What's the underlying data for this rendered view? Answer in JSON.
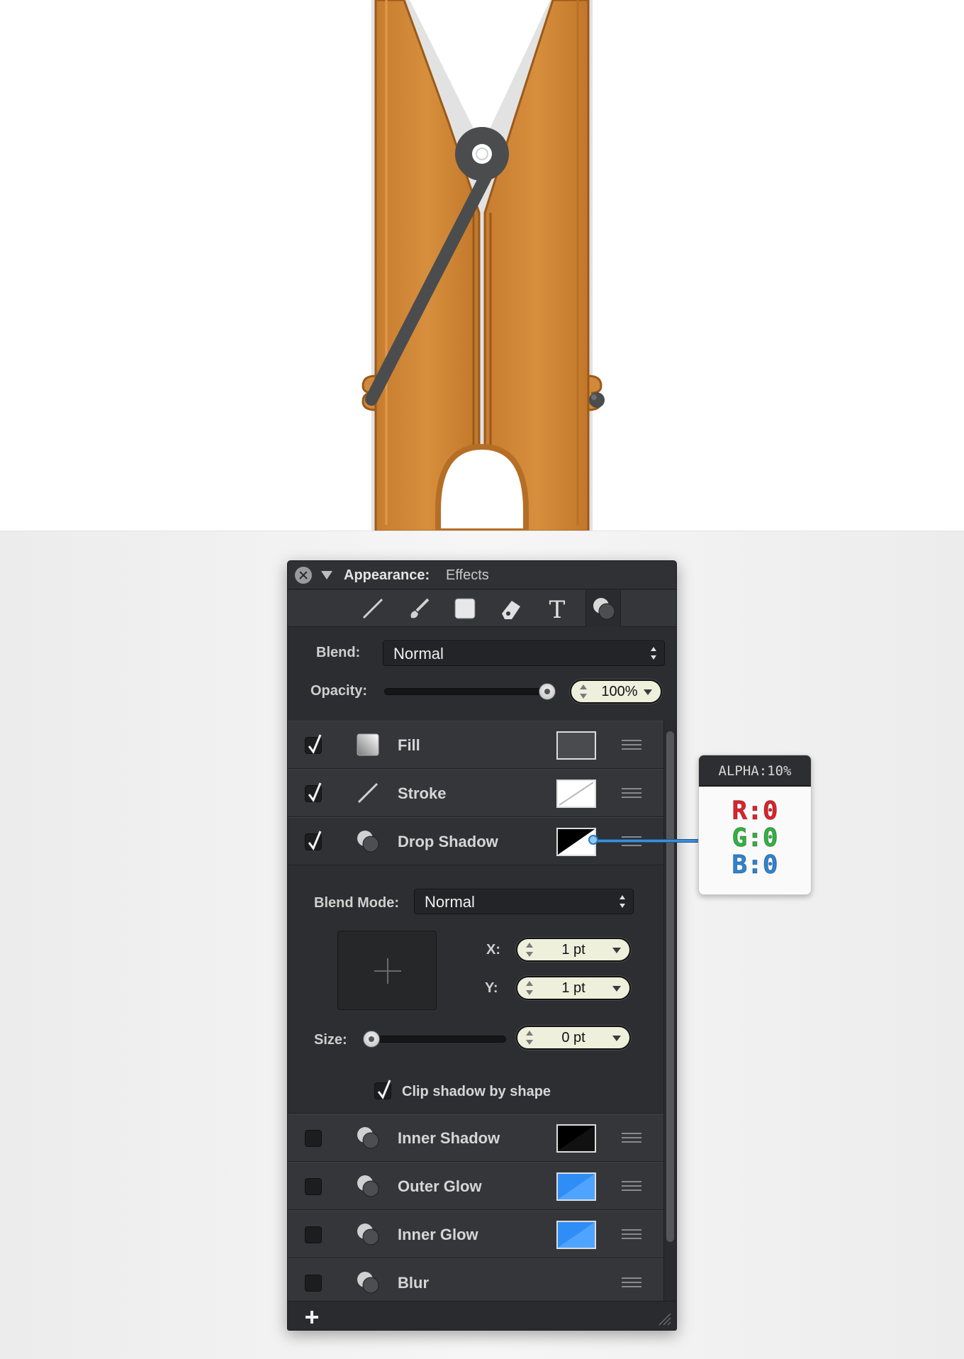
{
  "panel": {
    "title_label": "Appearance:",
    "title_value": "Effects",
    "tools": [
      "stroke-tool-icon",
      "brush-tool-icon",
      "fill-tool-icon",
      "eraser-tool-icon",
      "text-tool-icon",
      "effects-tool-icon"
    ],
    "blend_label": "Blend:",
    "blend_value": "Normal",
    "opacity_label": "Opacity:",
    "opacity_value": "100%",
    "opacity_level": 1.0,
    "rows_top": [
      {
        "label": "Fill",
        "checked": true,
        "icon": "fill-gradient-icon",
        "swatch": "#4a4b4e"
      },
      {
        "label": "Stroke",
        "checked": true,
        "icon": "line-icon",
        "swatch": "none"
      },
      {
        "label": "Drop Shadow",
        "checked": true,
        "icon": "effect-circles-icon",
        "swatch": "#000000"
      }
    ],
    "drop_shadow": {
      "blend_mode_label": "Blend Mode:",
      "blend_mode_value": "Normal",
      "x_label": "X:",
      "x_value": "1 pt",
      "y_label": "Y:",
      "y_value": "1 pt",
      "size_label": "Size:",
      "size_value": "0 pt",
      "size_level": 0.0,
      "clip_label": "Clip shadow by shape",
      "clip_checked": true
    },
    "rows_bottom": [
      {
        "label": "Inner Shadow",
        "checked": false,
        "icon": "effect-circles-icon",
        "swatch": "#000000"
      },
      {
        "label": "Outer Glow",
        "checked": false,
        "icon": "effect-circles-icon",
        "swatch": "#2f8ef5"
      },
      {
        "label": "Inner Glow",
        "checked": false,
        "icon": "effect-circles-icon",
        "swatch": "#2f8ef5"
      },
      {
        "label": "Blur",
        "checked": false,
        "icon": "effect-circles-icon",
        "swatch": ""
      }
    ]
  },
  "tooltip": {
    "alpha": "ALPHA:10%",
    "r": "R:0",
    "g": "G:0",
    "b": "B:0",
    "colors": {
      "r": "#e0222a",
      "g": "#2db53f",
      "b": "#2b84d6"
    }
  },
  "artwork": {
    "wood_color": "#d1893a",
    "spring_color": "#4b4c4e"
  }
}
